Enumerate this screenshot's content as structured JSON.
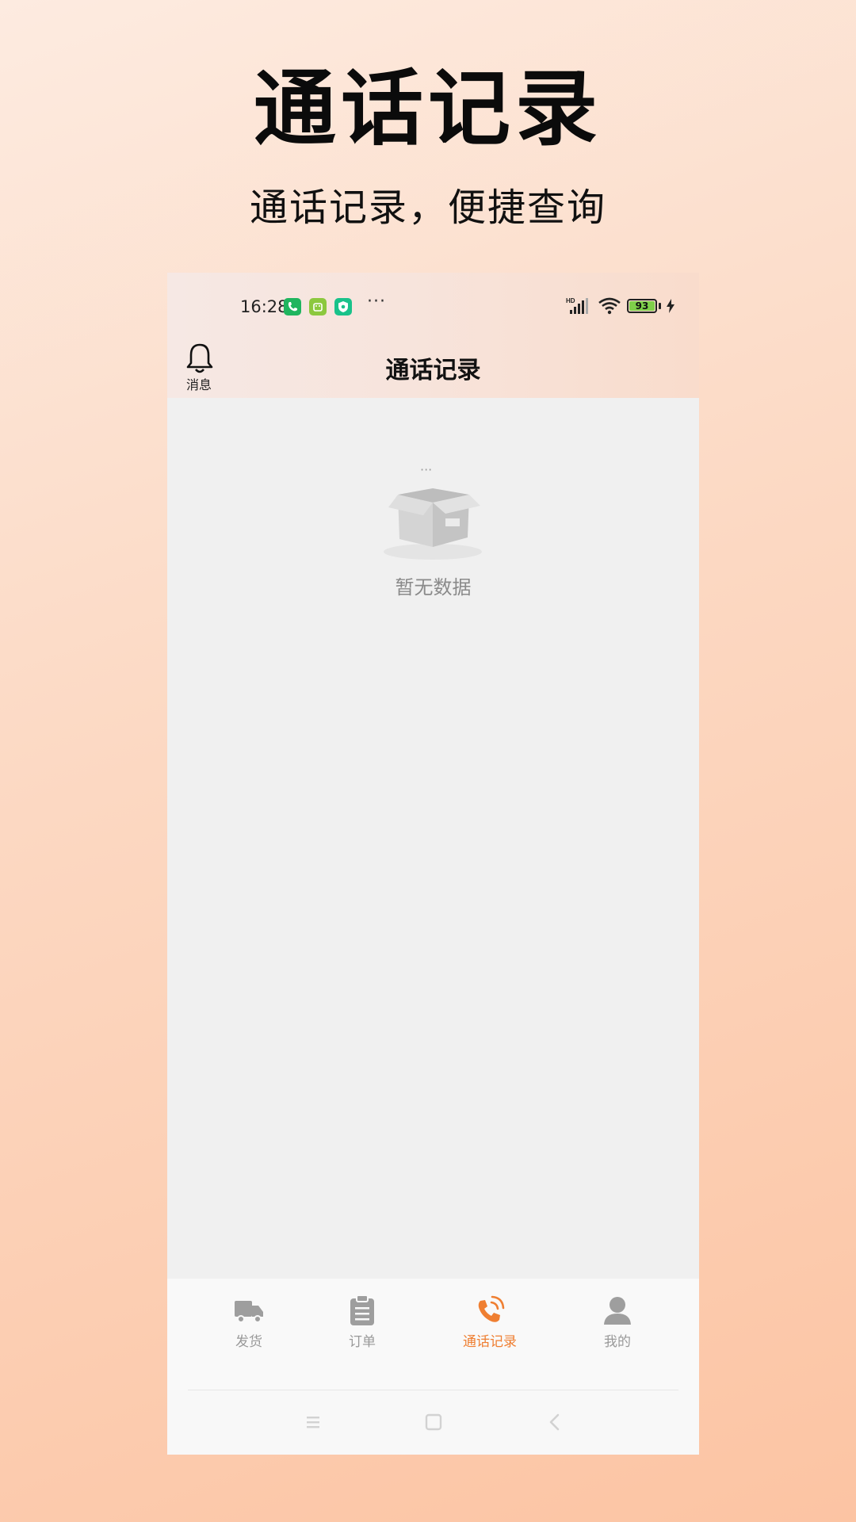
{
  "promo": {
    "title": "通话记录",
    "subtitle": "通话记录，便捷查询"
  },
  "status_bar": {
    "time": "16:28",
    "app_icons": [
      "phone-icon",
      "android-icon",
      "security-icon"
    ],
    "more": "···",
    "signal_label": "HD",
    "battery_level": "93",
    "battery_color": "#7fd04a",
    "charging": true
  },
  "header": {
    "notification_label": "消息",
    "title": "通话记录"
  },
  "empty_state": {
    "dots": "···",
    "message": "暂无数据"
  },
  "tab_bar": {
    "active_color": "#ef7f32",
    "inactive_color": "#9e9e9e",
    "tabs": [
      {
        "label": "发货",
        "icon": "truck-icon",
        "active": false
      },
      {
        "label": "订单",
        "icon": "clipboard-icon",
        "active": false
      },
      {
        "label": "通话记录",
        "icon": "phone-call-icon",
        "active": true
      },
      {
        "label": "我的",
        "icon": "user-icon",
        "active": false
      }
    ]
  },
  "system_nav": {
    "buttons": [
      "menu-icon",
      "home-icon",
      "back-icon"
    ]
  }
}
